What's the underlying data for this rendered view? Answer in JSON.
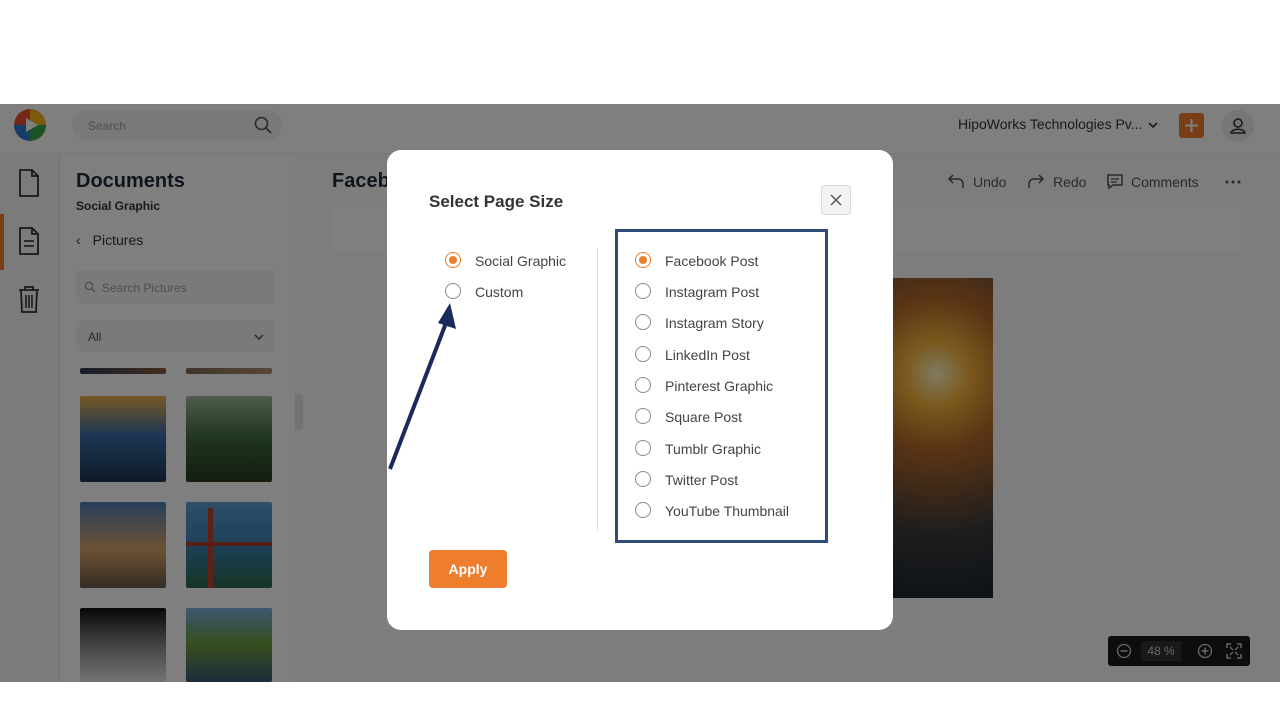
{
  "topbar": {
    "search_placeholder": "Search",
    "organization": "HipoWorks Technologies Pv..."
  },
  "sidebar": {
    "icons": [
      "document-icon",
      "file-text-icon",
      "trash-icon"
    ],
    "active_index": 1
  },
  "panel": {
    "title": "Documents",
    "subtitle": "Social Graphic",
    "back_label": "Pictures",
    "search_placeholder": "Search Pictures",
    "filter_value": "All"
  },
  "main": {
    "title": "Faceb",
    "toolbar": {
      "undo": "Undo",
      "redo": "Redo",
      "comments": "Comments"
    },
    "zoom": {
      "value": "48",
      "unit": "%"
    }
  },
  "modal": {
    "title": "Select Page Size",
    "left_options": [
      {
        "label": "Social Graphic",
        "checked": true
      },
      {
        "label": "Custom",
        "checked": false
      }
    ],
    "right_options": [
      {
        "label": "Facebook Post",
        "checked": true
      },
      {
        "label": "Instagram Post",
        "checked": false
      },
      {
        "label": "Instagram Story",
        "checked": false
      },
      {
        "label": "LinkedIn Post",
        "checked": false
      },
      {
        "label": "Pinterest Graphic",
        "checked": false
      },
      {
        "label": "Square Post",
        "checked": false
      },
      {
        "label": "Tumblr Graphic",
        "checked": false
      },
      {
        "label": "Twitter Post",
        "checked": false
      },
      {
        "label": "YouTube Thumbnail",
        "checked": false
      }
    ],
    "apply_label": "Apply"
  },
  "colors": {
    "accent": "#ee7d2e",
    "highlight_border": "#2f4d78",
    "arrow": "#1b2a5c"
  }
}
